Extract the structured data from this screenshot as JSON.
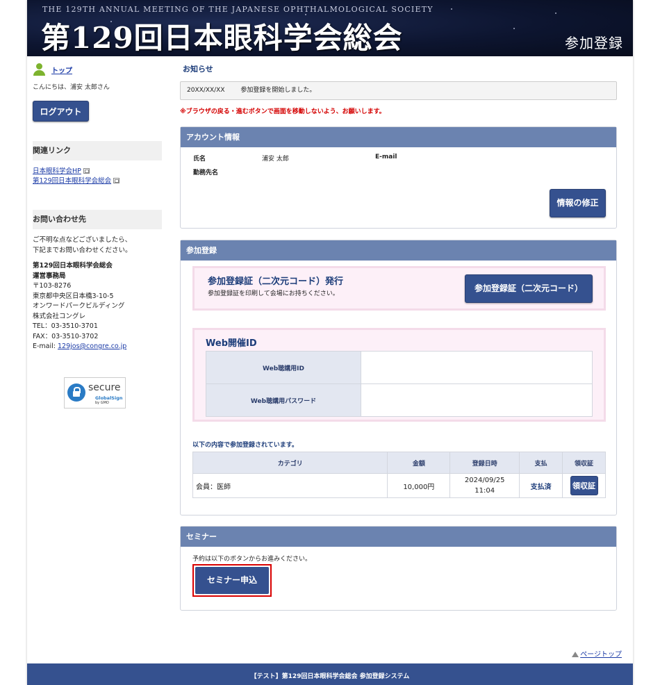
{
  "header": {
    "subtitle": "THE 129TH ANNUAL MEETING OF THE JAPANESE OPHTHALMOLOGICAL SOCIETY",
    "title": "第129回日本眼科学会総会",
    "section": "参加登録"
  },
  "sidebar": {
    "top_link": "トップ",
    "greeting": "こんにちは、浦安 太郎さん",
    "logout": "ログアウト",
    "links_heading": "関連リンク",
    "links": [
      "日本眼科学会HP",
      "第129回日本眼科学会総会"
    ],
    "contact_heading": "お問い合わせ先",
    "contact_intro1": "ご不明な点などございましたら、",
    "contact_intro2": "下記までお問い合わせください。",
    "org1": "第129回日本眼科学会総会",
    "org2": "運営事務局",
    "postal": "〒103-8276",
    "address1": "東京都中央区日本橋3-10-5",
    "address2": "オンワードパークビルディング",
    "company": "株式会社コングレ",
    "tel": "TEL：03-3510-3701",
    "fax": "FAX：03-3510-3702",
    "email_label": "E-mail: ",
    "email": "129jos@congre.co.jp",
    "ssl": {
      "badge": "SSL",
      "word": "secure",
      "brand": "GlobalSign",
      "by": "by GMO"
    }
  },
  "notice": {
    "title": "お知らせ",
    "date": "20XX/XX/XX",
    "text": "参加登録を開始しました。",
    "warning": "※ブラウザの戻る・進むボタンで画面を移動しないよう、お願いします。"
  },
  "account": {
    "heading": "アカウント情報",
    "name_label": "氏名",
    "name_value": "浦安 太郎",
    "email_label": "E-mail",
    "workplace_label": "勤務先名",
    "edit_button": "情報の修正"
  },
  "registration": {
    "heading": "参加登録",
    "code_title": "参加登録証（二次元コード）発行",
    "code_sub": "参加登録証を印刷して会場にお持ちください。",
    "code_button": "参加登録証（二次元コード）",
    "web_title": "Web開催ID",
    "web_id_label": "Web聴講用ID",
    "web_pw_label": "Web聴講用パスワード",
    "note": "以下の内容で参加登録されています。",
    "columns": [
      "カテゴリ",
      "金額",
      "登録日時",
      "支払",
      "領収証"
    ],
    "row": {
      "category": "会員：医師",
      "amount": "10,000円",
      "date": "2024/09/25",
      "time": "11:04",
      "payment": "支払済",
      "receipt": "領収証"
    }
  },
  "seminar": {
    "heading": "セミナー",
    "note": "予約は以下のボタンからお進みください。",
    "button": "セミナー申込"
  },
  "page_top": "ページトップ",
  "footer": "【テスト】第129回日本眼科学会総会 参加登録システム"
}
